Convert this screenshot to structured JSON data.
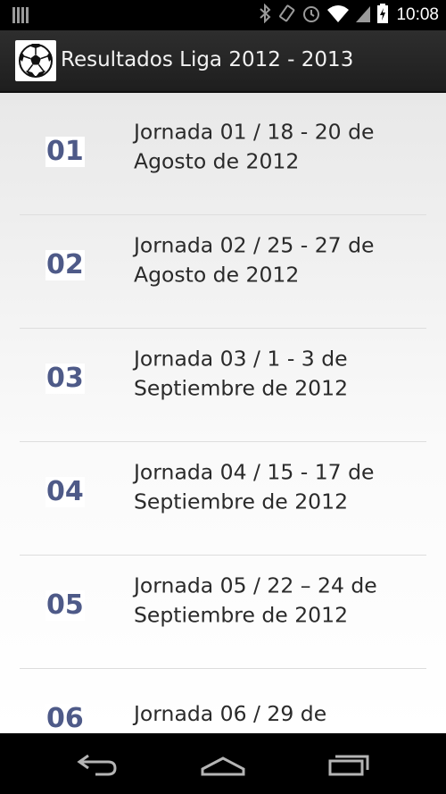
{
  "status_bar": {
    "time": "10:08",
    "icons": [
      "signal-bars-icon",
      "bluetooth-icon",
      "vibrate-icon",
      "alarm-icon",
      "wifi-icon",
      "cell-signal-icon",
      "battery-charging-icon"
    ]
  },
  "action_bar": {
    "title": "Resultados Liga 2012 - 2013",
    "icon": "soccer-ball-icon"
  },
  "jornadas": [
    {
      "num": "01",
      "label": "Jornada 01 / 18 - 20 de Agosto de 2012"
    },
    {
      "num": "02",
      "label": "Jornada 02 / 25 - 27 de Agosto de 2012"
    },
    {
      "num": "03",
      "label": "Jornada 03 / 1 - 3 de Septiembre de 2012"
    },
    {
      "num": "04",
      "label": "Jornada 04 / 15 - 17 de Septiembre de 2012"
    },
    {
      "num": "05",
      "label": "Jornada 05 / 22 – 24 de Septiembre de 2012"
    },
    {
      "num": "06",
      "label": "Jornada 06 / 29 de"
    }
  ],
  "nav_bar": {
    "buttons": [
      "back-icon",
      "home-icon",
      "recent-apps-icon"
    ]
  },
  "colors": {
    "number": "#4e5a88",
    "text": "#2a2a2a",
    "action_bar": "#262626"
  }
}
